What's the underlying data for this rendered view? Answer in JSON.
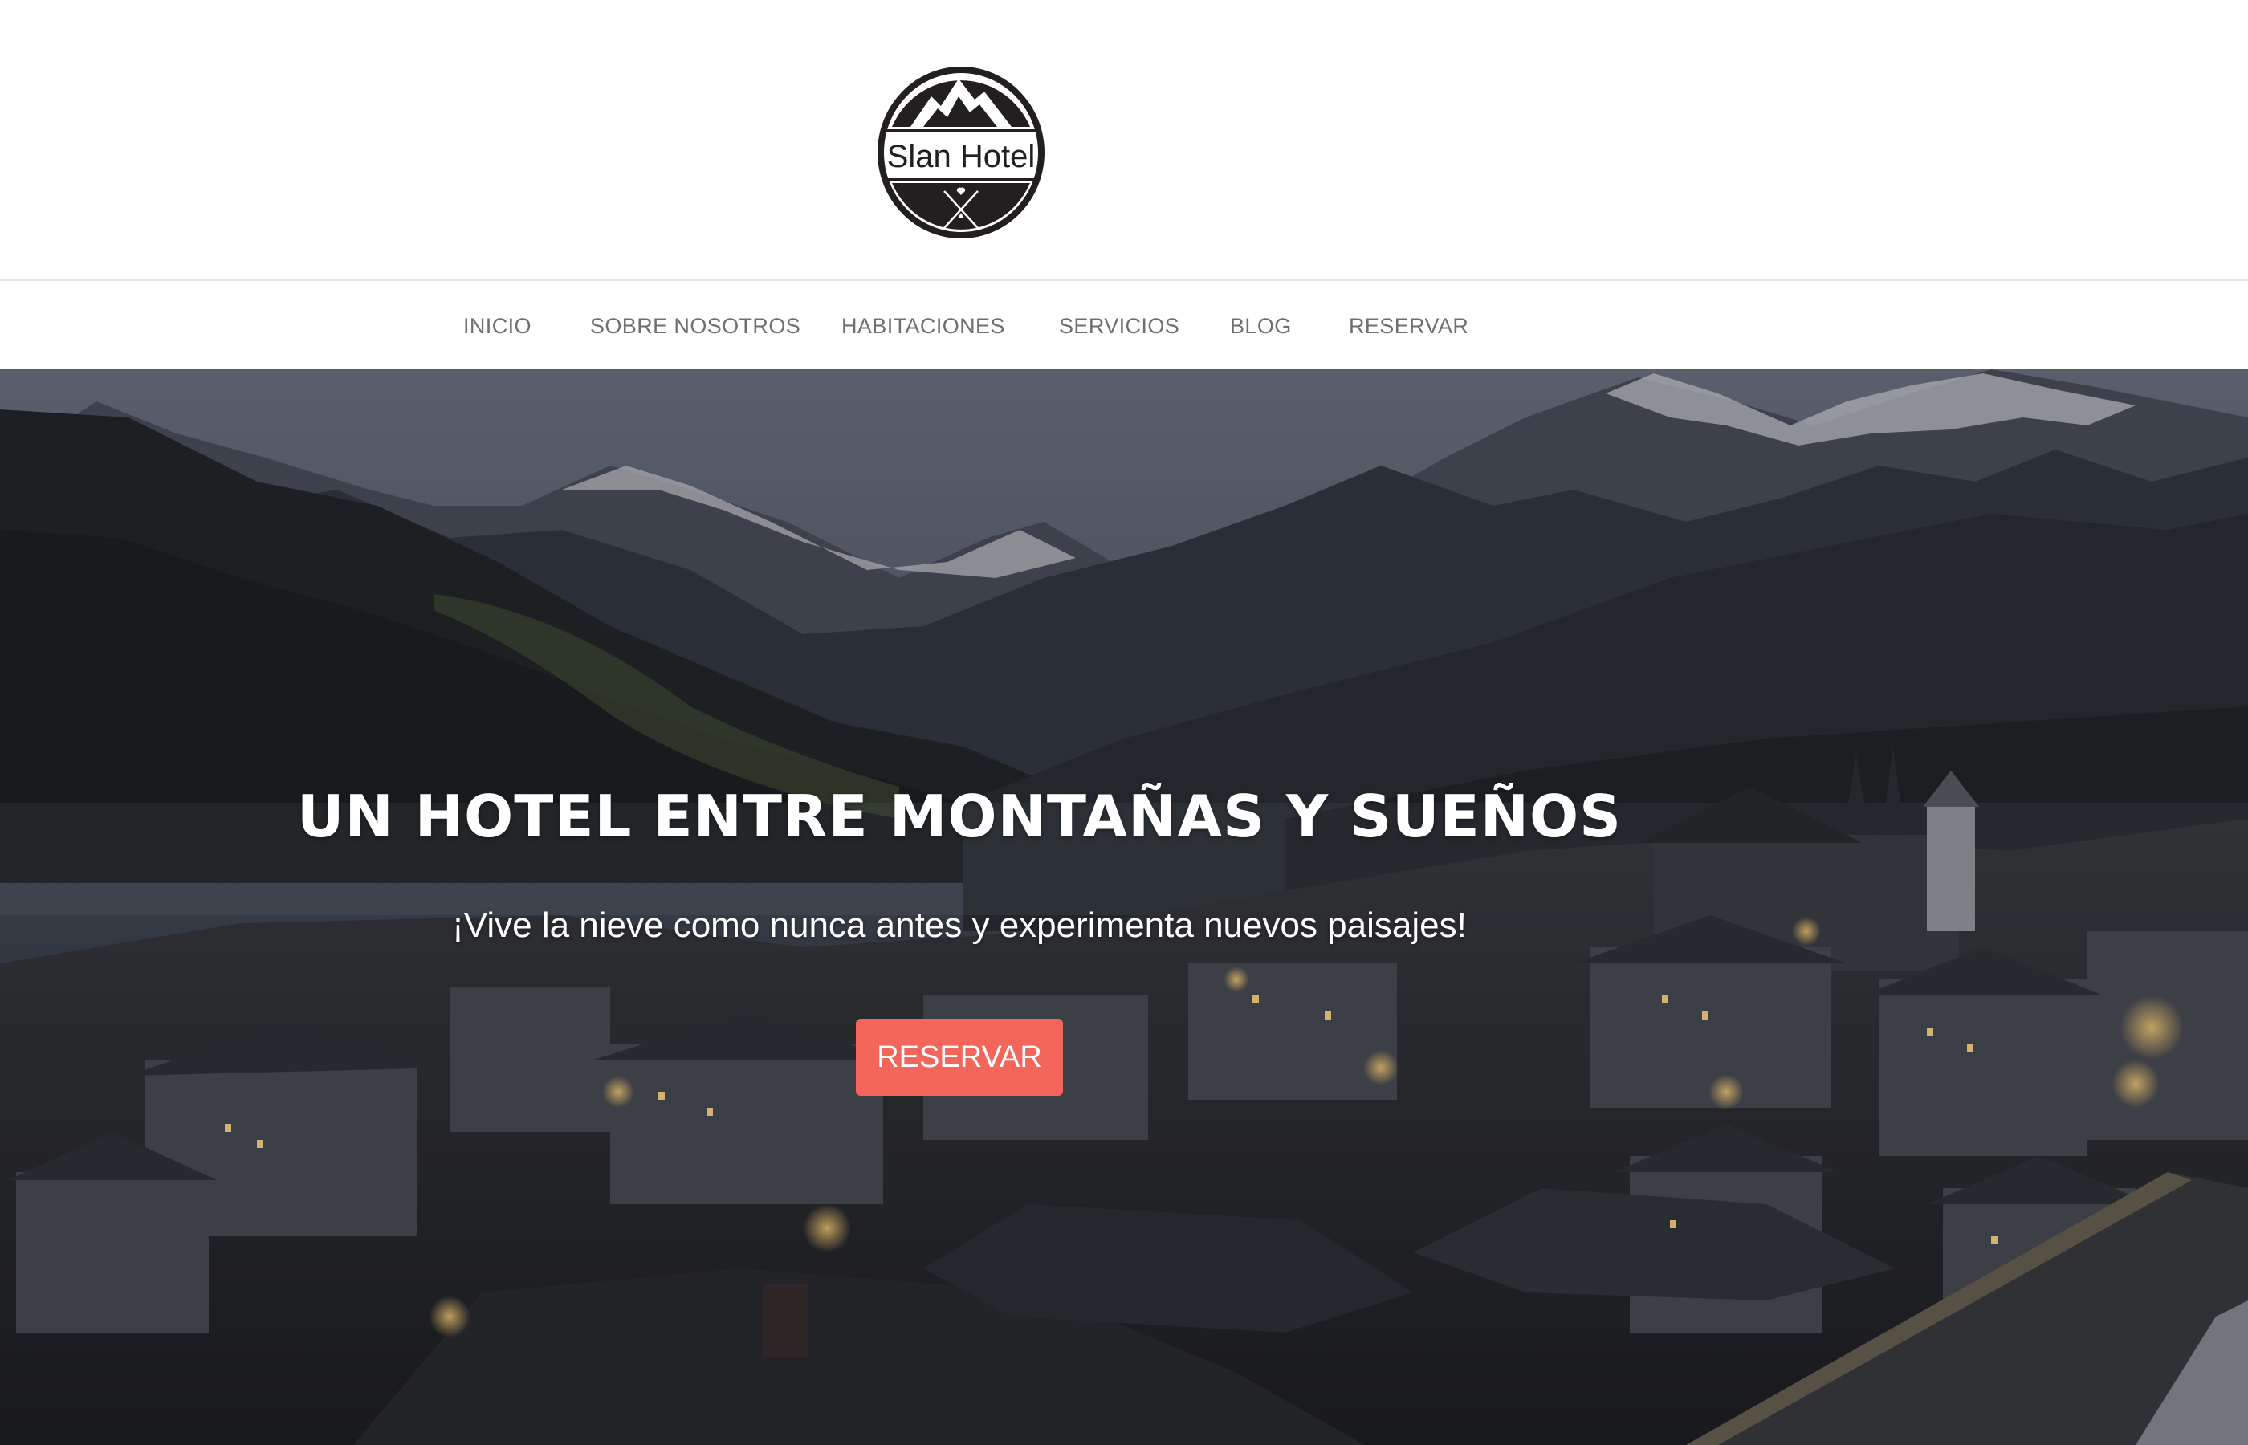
{
  "brand": {
    "logo_text": "Slan Hotel"
  },
  "nav": {
    "items": [
      {
        "label": "INICIO"
      },
      {
        "label": "SOBRE NOSOTROS"
      },
      {
        "label": "HABITACIONES"
      },
      {
        "label": "SERVICIOS"
      },
      {
        "label": "BLOG"
      },
      {
        "label": "RESERVAR"
      }
    ]
  },
  "hero": {
    "title": "UN HOTEL ENTRE MONTAÑAS Y SUEÑOS",
    "subtitle": "¡Vive la nieve como nunca antes y experimenta nuevos paisajes!",
    "button_label": "RESERVAR"
  },
  "colors": {
    "accent_button": "#f4665c",
    "nav_text": "#6f6f6f",
    "logo_dark": "#231f20"
  }
}
